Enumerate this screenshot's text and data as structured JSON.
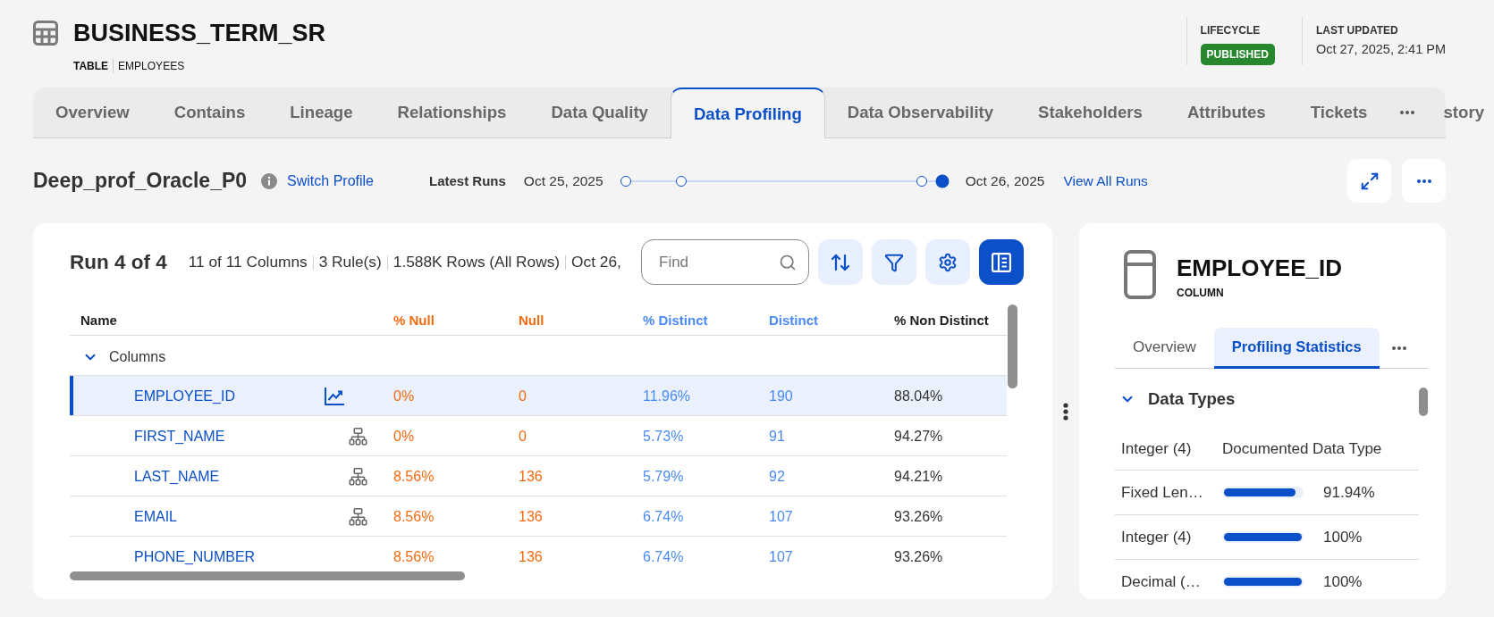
{
  "header": {
    "title": "BUSINESS_TERM_SR",
    "object_type": "TABLE",
    "object_name": "EMPLOYEES",
    "lifecycle": {
      "label": "LIFECYCLE",
      "status": "PUBLISHED"
    },
    "last_updated": {
      "label": "LAST UPDATED",
      "value": "Oct 27, 2025, 2:41 PM"
    }
  },
  "tabs": [
    {
      "kind": "tab",
      "label": "Overview",
      "selected": false
    },
    {
      "kind": "tab",
      "label": "Contains",
      "selected": false
    },
    {
      "kind": "tab",
      "label": "Lineage",
      "selected": false
    },
    {
      "kind": "tab",
      "label": "Relationships",
      "selected": false
    },
    {
      "kind": "tab",
      "label": "Data Quality",
      "selected": false
    },
    {
      "kind": "tab",
      "label": "Data Profiling",
      "selected": true
    },
    {
      "kind": "tab",
      "label": "Data Observability",
      "selected": false
    },
    {
      "kind": "tab",
      "label": "Stakeholders",
      "selected": false
    },
    {
      "kind": "tab",
      "label": "Attributes",
      "selected": false
    },
    {
      "kind": "tab",
      "label": "Tickets",
      "selected": false
    },
    {
      "kind": "more"
    },
    {
      "kind": "tab",
      "label": "story",
      "selected": false
    }
  ],
  "profile": {
    "name": "Deep_prof_Oracle_P0",
    "switch_link": "Switch Profile",
    "runs_label": "Latest Runs",
    "first_date": "Oct 25, 2025",
    "run_points": [
      {
        "selected": false
      },
      {
        "selected": false
      },
      {
        "selected": false
      },
      {
        "selected": true
      }
    ],
    "last_date": "Oct 26, 2025",
    "view_all_link": "View All Runs"
  },
  "run_panel": {
    "title": "Run 4 of 4",
    "summary": [
      "11 of 11 Columns",
      "3 Rule(s)",
      "1.588K Rows (All Rows)",
      "Oct 26,"
    ],
    "search": {
      "placeholder": "Find"
    },
    "tool_buttons": [
      {
        "kind": "sort",
        "selected": false
      },
      {
        "kind": "filter",
        "selected": false
      },
      {
        "kind": "settings",
        "selected": false
      },
      {
        "kind": "details",
        "selected": true
      }
    ],
    "table": {
      "columns": [
        {
          "label": "Name"
        },
        {
          "label": "% Null",
          "color": "#f46a10"
        },
        {
          "label": "Null",
          "color": "#f46a10"
        },
        {
          "label": "% Distinct",
          "color": "#4a8af4"
        },
        {
          "label": "Distinct",
          "color": "#4a8af4"
        },
        {
          "label": "% Non Distinct"
        }
      ],
      "group": {
        "label": "Columns",
        "expanded": true
      },
      "rows": [
        {
          "kind": "trend",
          "selected": true,
          "cells": [
            "EMPLOYEE_ID",
            "0%",
            "0",
            "11.96%",
            "190",
            "88.04%"
          ]
        },
        {
          "kind": "tree",
          "selected": false,
          "cells": [
            "FIRST_NAME",
            "0%",
            "0",
            "5.73%",
            "91",
            "94.27%"
          ]
        },
        {
          "kind": "tree",
          "selected": false,
          "cells": [
            "LAST_NAME",
            "8.56%",
            "136",
            "5.79%",
            "92",
            "94.21%"
          ]
        },
        {
          "kind": "tree",
          "selected": false,
          "cells": [
            "EMAIL",
            "8.56%",
            "136",
            "6.74%",
            "107",
            "93.26%"
          ]
        },
        {
          "kind": "plain",
          "selected": false,
          "cells": [
            "PHONE_NUMBER",
            "8.56%",
            "136",
            "6.74%",
            "107",
            "93.26%"
          ]
        }
      ]
    }
  },
  "detail_panel": {
    "title": "EMPLOYEE_ID",
    "object_type": "COLUMN",
    "tabs": [
      {
        "kind": "tab",
        "label": "Overview",
        "selected": false
      },
      {
        "kind": "tab",
        "label": "Profiling Statistics",
        "selected": true
      },
      {
        "kind": "more"
      }
    ],
    "section": {
      "title": "Data Types",
      "expanded": true,
      "documented_value": "Integer (4)",
      "documented_label": "Documented Data Type",
      "rows": [
        {
          "name": "Fixed Len…",
          "level": 0.9194,
          "reading": "91.94%"
        },
        {
          "name": "Integer (4)",
          "level": 1,
          "reading": "100%"
        },
        {
          "name": "Decimal (…",
          "level": 1,
          "reading": "100%"
        }
      ]
    }
  }
}
